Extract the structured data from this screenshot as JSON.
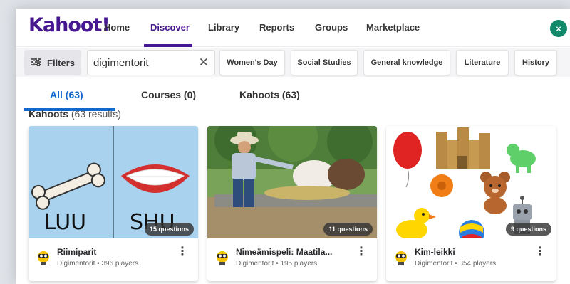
{
  "nav": {
    "logo": "Kahoot!",
    "items": [
      "Home",
      "Discover",
      "Library",
      "Reports",
      "Groups",
      "Marketplace"
    ],
    "active": "Discover",
    "accent": "#46178f"
  },
  "filters": {
    "button_label": "Filters",
    "search_value": "digimentorit",
    "chips": [
      "Women's Day",
      "Social Studies",
      "General knowledge",
      "Literature",
      "History"
    ]
  },
  "tabs": {
    "all": "All (63)",
    "courses": "Courses (0)",
    "kahoots": "Kahoots (63)",
    "active_color": "#1368ce"
  },
  "results": {
    "heading": "Kahoots",
    "count": "(63 results)"
  },
  "cards": [
    {
      "title": "Riimiparit",
      "creator": "Digimentorit",
      "players": "396 players",
      "questions": "15 questions",
      "thumb_words": [
        "LUU",
        "SHU"
      ]
    },
    {
      "title": "Nimeämispeli: Maatila...",
      "creator": "Digimentorit",
      "players": "195 players",
      "questions": "11 questions"
    },
    {
      "title": "Kim-leikki",
      "creator": "Digimentorit",
      "players": "354 players",
      "questions": "9 questions"
    }
  ],
  "separator": "•"
}
